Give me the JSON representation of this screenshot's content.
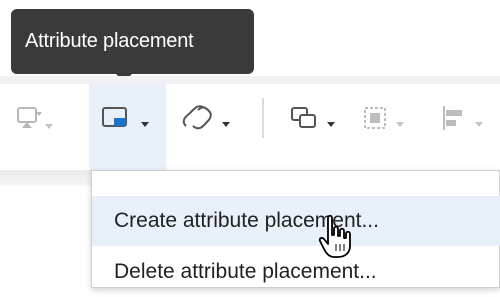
{
  "tooltip": {
    "text": "Attribute placement"
  },
  "toolbar": {
    "tools": [
      {
        "icon": "insert-frame-icon",
        "state": "disabled"
      },
      {
        "icon": "attribute-placement-icon",
        "state": "active"
      },
      {
        "icon": "link-icon",
        "state": "enabled"
      },
      {
        "icon": "overlap-shapes-icon",
        "state": "enabled"
      },
      {
        "icon": "group-frame-icon",
        "state": "disabled"
      },
      {
        "icon": "align-left-icon",
        "state": "disabled"
      }
    ]
  },
  "menu": {
    "items": [
      {
        "label": "Create attribute placement..."
      },
      {
        "label": "Delete attribute placement..."
      }
    ]
  },
  "colors": {
    "accent_blue": "#1c73c7",
    "active_bg": "#e8f1fa",
    "tooltip_bg": "#3a3a3a"
  }
}
